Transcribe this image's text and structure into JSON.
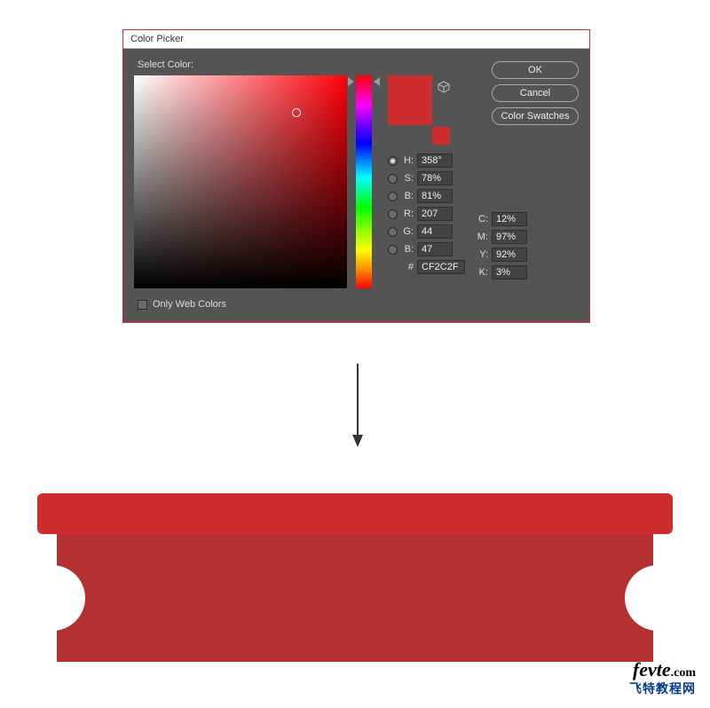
{
  "dialog": {
    "title": "Color Picker",
    "select_label": "Select Color:",
    "only_web_label": "Only Web Colors"
  },
  "buttons": {
    "ok": "OK",
    "cancel": "Cancel",
    "swatches": "Color Swatches"
  },
  "color": {
    "hex_prefix": "#",
    "hex": "CF2C2F",
    "current": "#cf2c2f",
    "previous": "#cf2c2f",
    "hsb": {
      "h": {
        "label": "H:",
        "value": "358°"
      },
      "s": {
        "label": "S:",
        "value": "78%"
      },
      "b": {
        "label": "B:",
        "value": "81%"
      }
    },
    "rgb": {
      "r": {
        "label": "R:",
        "value": "207"
      },
      "g": {
        "label": "G:",
        "value": "44"
      },
      "b": {
        "label": "B:",
        "value": "47"
      }
    },
    "cmyk": {
      "c": {
        "label": "C:",
        "value": "12%"
      },
      "m": {
        "label": "M:",
        "value": "97%"
      },
      "y": {
        "label": "Y:",
        "value": "92%"
      },
      "k": {
        "label": "K:",
        "value": "3%"
      }
    }
  },
  "watermark": {
    "main": "fevte",
    "suffix": ".com",
    "sub": "飞特教程网"
  }
}
